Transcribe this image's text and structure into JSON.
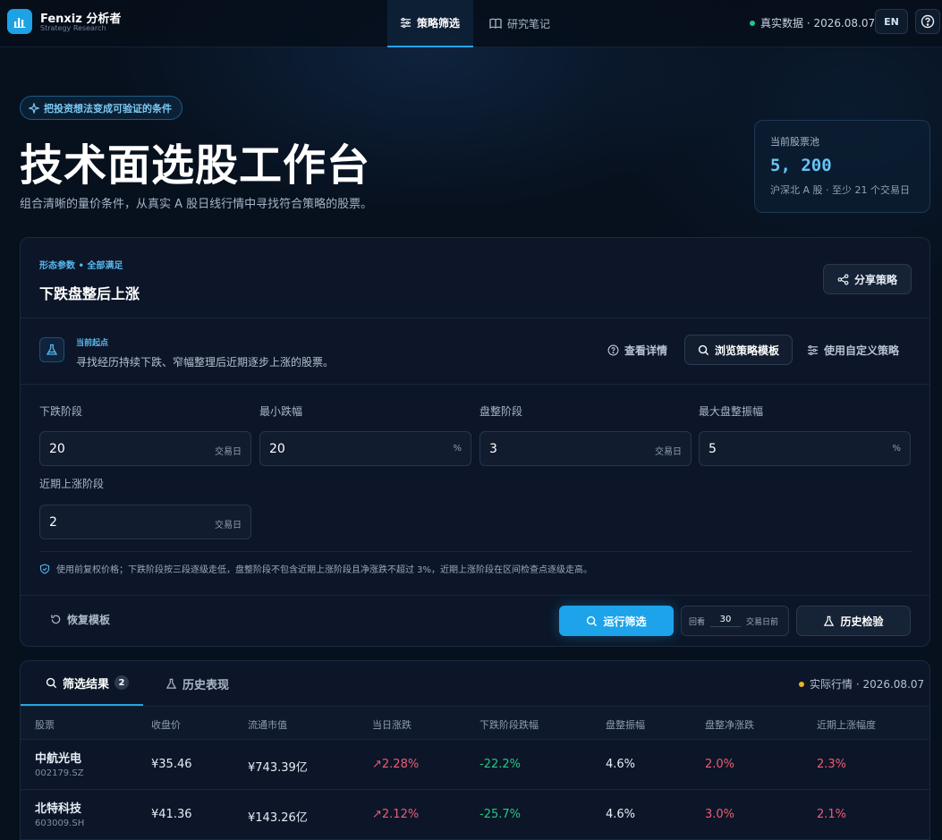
{
  "colors": {
    "accent": "#1da3ea",
    "up": "#ef5b73",
    "down": "#24c883",
    "bg": "#07101d",
    "panel": "#0c1628"
  },
  "brand": {
    "name": "Fenxiz 分析者",
    "subtitle": "Strategy Research"
  },
  "nav": {
    "tabs": [
      {
        "label": "策略筛选",
        "icon": "sliders-icon",
        "active": true
      },
      {
        "label": "研究笔记",
        "icon": "book-icon",
        "active": false
      }
    ],
    "status": "真实数据 · 2026.08.07",
    "lang": "EN"
  },
  "hero": {
    "pill": "把投资想法变成可验证的条件",
    "title": "技术面选股工作台",
    "description": "组合清晰的量价条件，从真实 A 股日线行情中寻找符合策略的股票。"
  },
  "pool": {
    "label": "当前股票池",
    "value": "5, 200",
    "sub": "沪深北 A 股 · 至少 21 个交易日"
  },
  "strategy": {
    "tag": "形态参数 • 全部满足",
    "title": "下跌盘整后上涨",
    "share": "分享策略",
    "start_label": "当前起点",
    "start_desc": "寻找经历持续下跌、窄幅整理后近期逐步上涨的股票。",
    "view_details": "查看详情",
    "browse_templates": "浏览策略模板",
    "custom_strategy": "使用自定义策略",
    "fields": [
      {
        "label": "下跌阶段",
        "value": "20",
        "unit": "交易日"
      },
      {
        "label": "最小跌幅",
        "value": "20",
        "unit": "%"
      },
      {
        "label": "盘整阶段",
        "value": "3",
        "unit": "交易日"
      },
      {
        "label": "最大盘整振幅",
        "value": "5",
        "unit": "%"
      },
      {
        "label": "近期上涨阶段",
        "value": "2",
        "unit": "交易日"
      }
    ],
    "note": "使用前复权价格；下跌阶段按三段逐级走低，盘整阶段不包含近期上涨阶段且净涨跌不超过 3%，近期上涨阶段在区间检查点逐级走高。",
    "reset": "恢复模板",
    "run": "运行筛选",
    "lookback_label": "回看",
    "lookback_value": "30",
    "lookback_unit": "交易日前",
    "history": "历史检验"
  },
  "results": {
    "tab_results": "筛选结果",
    "count": "2",
    "tab_history": "历史表现",
    "status": "实际行情 · 2026.08.07",
    "columns": [
      "股票",
      "收盘价",
      "流通市值",
      "当日涨跌",
      "下跌阶段跌幅",
      "盘整振幅",
      "盘整净涨跌",
      "近期上涨幅度"
    ],
    "rows": [
      {
        "name": "中航光电",
        "code": "002179.SZ",
        "close": "¥35.46",
        "cap": "¥743.39亿",
        "change": "2.28%",
        "drop": "-22.2%",
        "amp": "4.6%",
        "net": "2.0%",
        "rise": "2.3%"
      },
      {
        "name": "北特科技",
        "code": "603009.SH",
        "close": "¥41.36",
        "cap": "¥143.26亿",
        "change": "2.12%",
        "drop": "-25.7%",
        "amp": "4.6%",
        "net": "3.0%",
        "rise": "2.1%"
      }
    ]
  }
}
